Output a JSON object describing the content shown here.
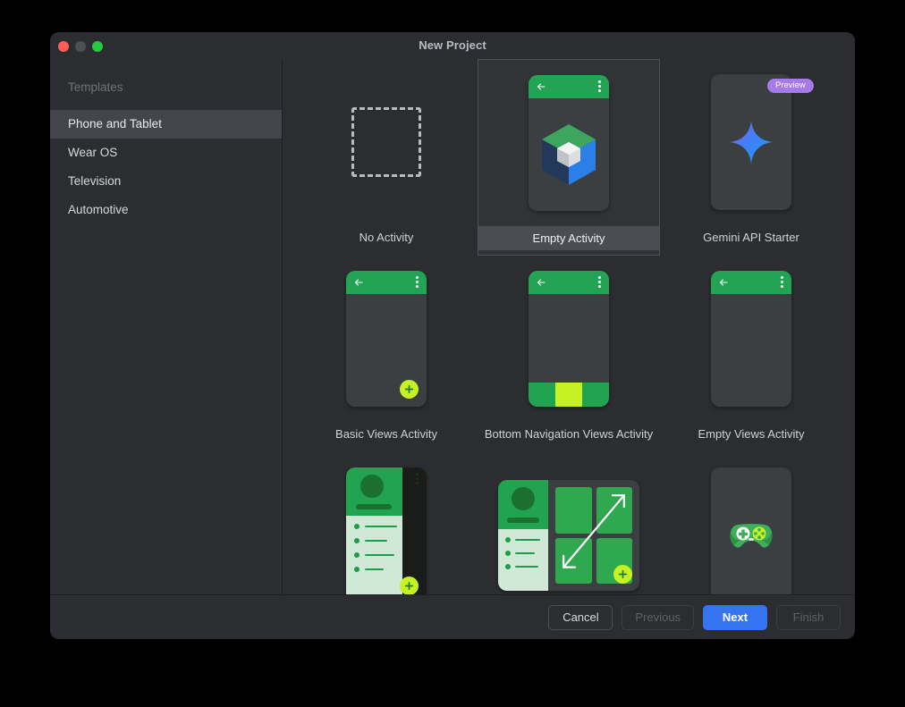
{
  "window": {
    "title": "New Project",
    "traffic_lights": [
      "close-button",
      "minimize-button",
      "maximize-button"
    ]
  },
  "sidebar": {
    "header": "Templates",
    "items": [
      {
        "label": "Phone and Tablet",
        "selected": true
      },
      {
        "label": "Wear OS",
        "selected": false
      },
      {
        "label": "Television",
        "selected": false
      },
      {
        "label": "Automotive",
        "selected": false
      }
    ]
  },
  "templates": [
    {
      "label": "No Activity",
      "selected": false,
      "badge": ""
    },
    {
      "label": "Empty Activity",
      "selected": true,
      "badge": ""
    },
    {
      "label": "Gemini API Starter",
      "selected": false,
      "badge": "Preview"
    },
    {
      "label": "Basic Views Activity",
      "selected": false,
      "badge": ""
    },
    {
      "label": "Bottom Navigation Views Activity",
      "selected": false,
      "badge": ""
    },
    {
      "label": "Empty Views Activity",
      "selected": false,
      "badge": ""
    },
    {
      "label": "",
      "selected": false,
      "badge": ""
    },
    {
      "label": "",
      "selected": false,
      "badge": ""
    },
    {
      "label": "",
      "selected": false,
      "badge": ""
    }
  ],
  "footer": {
    "cancel": "Cancel",
    "previous": "Previous",
    "next": "Next",
    "finish": "Finish"
  },
  "colors": {
    "accent_blue": "#3574F0",
    "android_green": "#23A455",
    "lime": "#C6F224",
    "preview_purple": "#A879E8",
    "window_bg": "#2B2D30",
    "selected_row": "#43454A",
    "page_bg": "#000000"
  }
}
